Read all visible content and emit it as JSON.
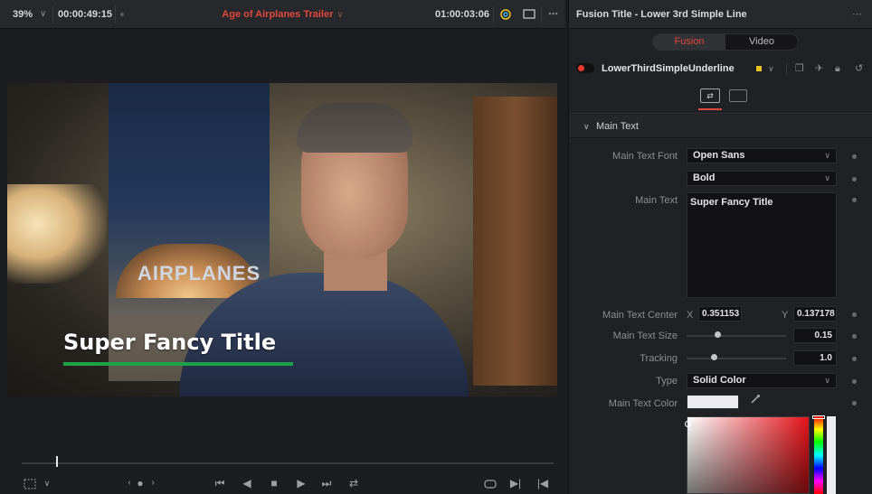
{
  "viewer": {
    "zoom": "39%",
    "source_timecode": "00:00:49:15",
    "timeline_name": "Age of Airplanes Trailer",
    "record_timecode": "01:00:03:06",
    "overlay_title": "Super Fancy Title",
    "playhead_fraction": 0.065
  },
  "inspector": {
    "title": "Fusion Title - Lower 3rd Simple Line",
    "tabs": [
      "Fusion",
      "Video"
    ],
    "active_tab": "Fusion",
    "node_name": "LowerThirdSimpleUnderline",
    "section_title": "Main Text",
    "font_label": "Main Text Font",
    "font_value": "Open Sans",
    "style_value": "Bold",
    "text_label": "Main Text",
    "text_value": "Super Fancy Title",
    "center_label": "Main Text Center",
    "center_x_label": "X",
    "center_x": "0.351153",
    "center_y_label": "Y",
    "center_y": "0.137178",
    "size_label": "Main Text Size",
    "size_value": "0.15",
    "tracking_label": "Tracking",
    "tracking_value": "1.0",
    "type_label": "Type",
    "type_value": "Solid Color",
    "color_label": "Main Text Color",
    "text_color": "#ececee"
  },
  "colors": {
    "accent_red": "#e0493f",
    "underline_green": "#1da24a",
    "node_color": "#e8c21b"
  },
  "icons": {
    "more": "⋯",
    "chevron_down": "∨",
    "chevron_right_section": "∨",
    "eyedropper": "⁄"
  }
}
